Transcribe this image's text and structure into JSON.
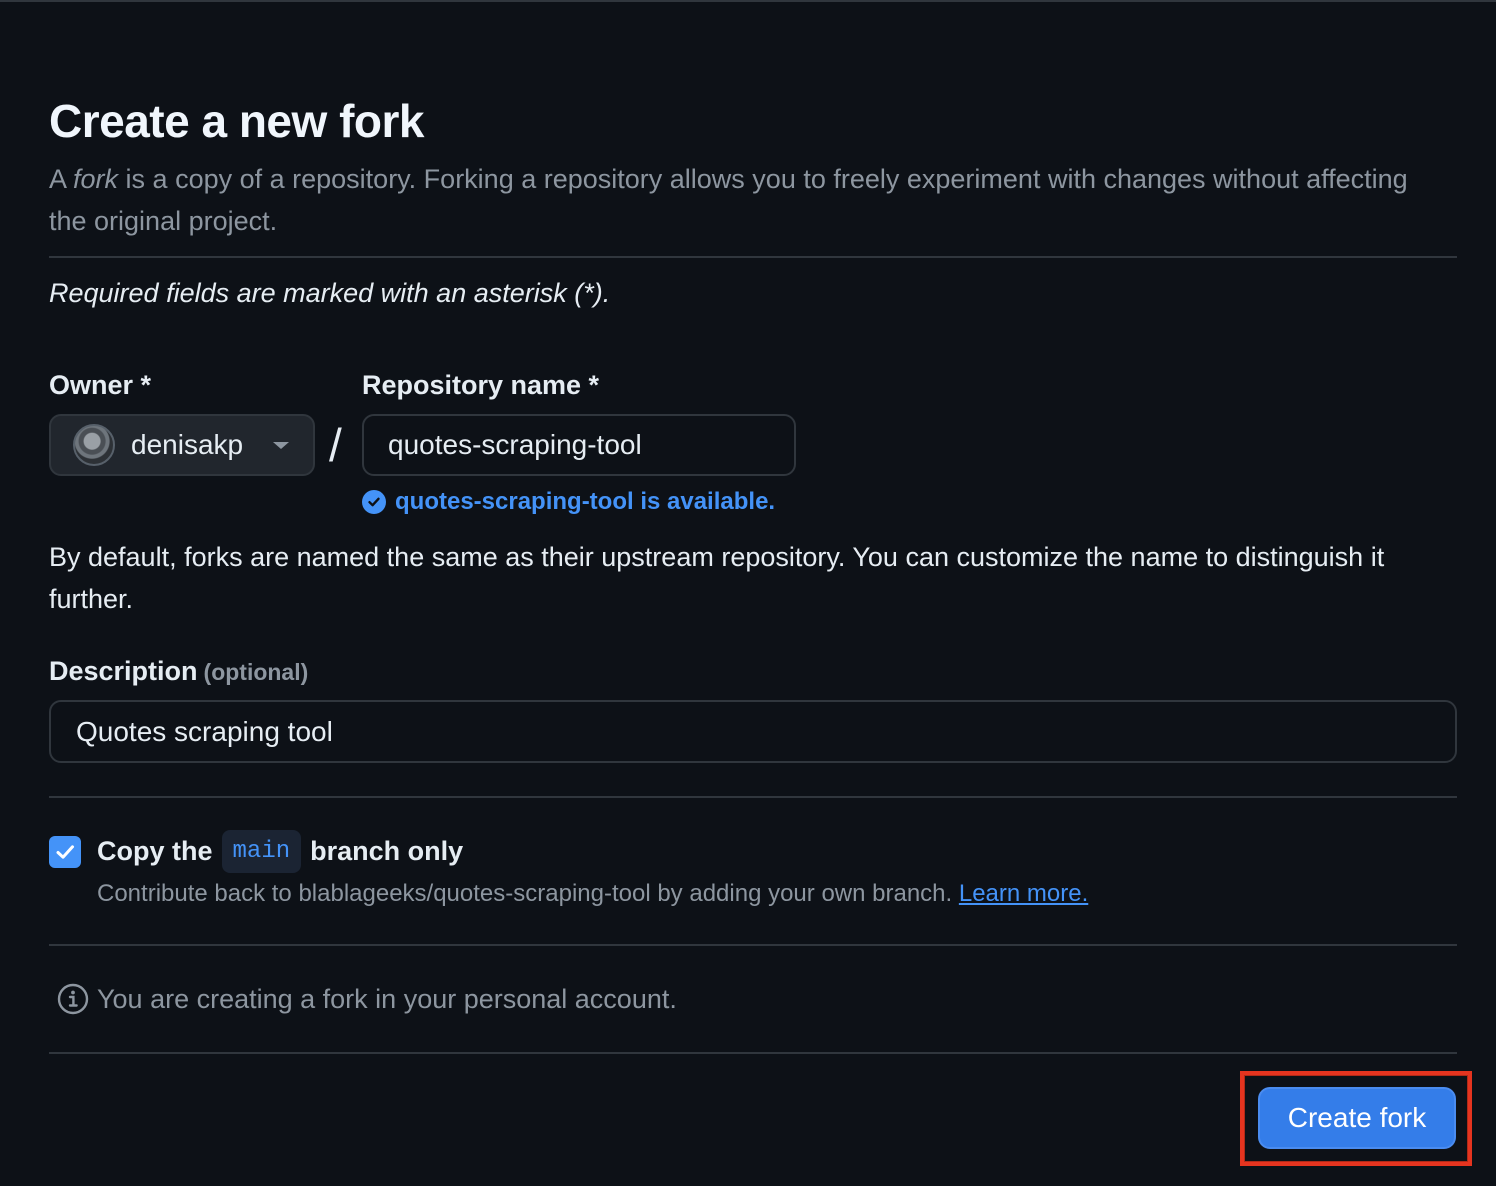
{
  "page": {
    "title": "Create a new fork",
    "intro_before": "A ",
    "intro_em": "fork",
    "intro_after": " is a copy of a repository. Forking a repository allows you to freely experiment with changes without affecting the original project.",
    "required_note": "Required fields are marked with an asterisk (*)."
  },
  "owner": {
    "label": "Owner *",
    "value": "denisakp",
    "icon": "chevron-down-icon"
  },
  "separator": "/",
  "repository": {
    "label": "Repository name *",
    "value": "quotes-scraping-tool",
    "availability": "quotes-scraping-tool is available.",
    "availability_color": "#4493f8"
  },
  "naming_note": "By default, forks are named the same as their upstream repository. You can customize the name to distinguish it further.",
  "description": {
    "label": "Description",
    "optional": "(optional)",
    "value": "Quotes scraping tool"
  },
  "copy_branch": {
    "checked": true,
    "label_before": "Copy the",
    "branch": "main",
    "label_after": "branch only",
    "note": "Contribute back to blablageeks/quotes-scraping-tool by adding your own branch.",
    "learn_more": "Learn more."
  },
  "info": {
    "text": "You are creating a fork in your personal account.",
    "icon": "info-icon"
  },
  "actions": {
    "create_fork": "Create fork",
    "accent": "#347de9",
    "highlight_color": "#e5341f"
  }
}
